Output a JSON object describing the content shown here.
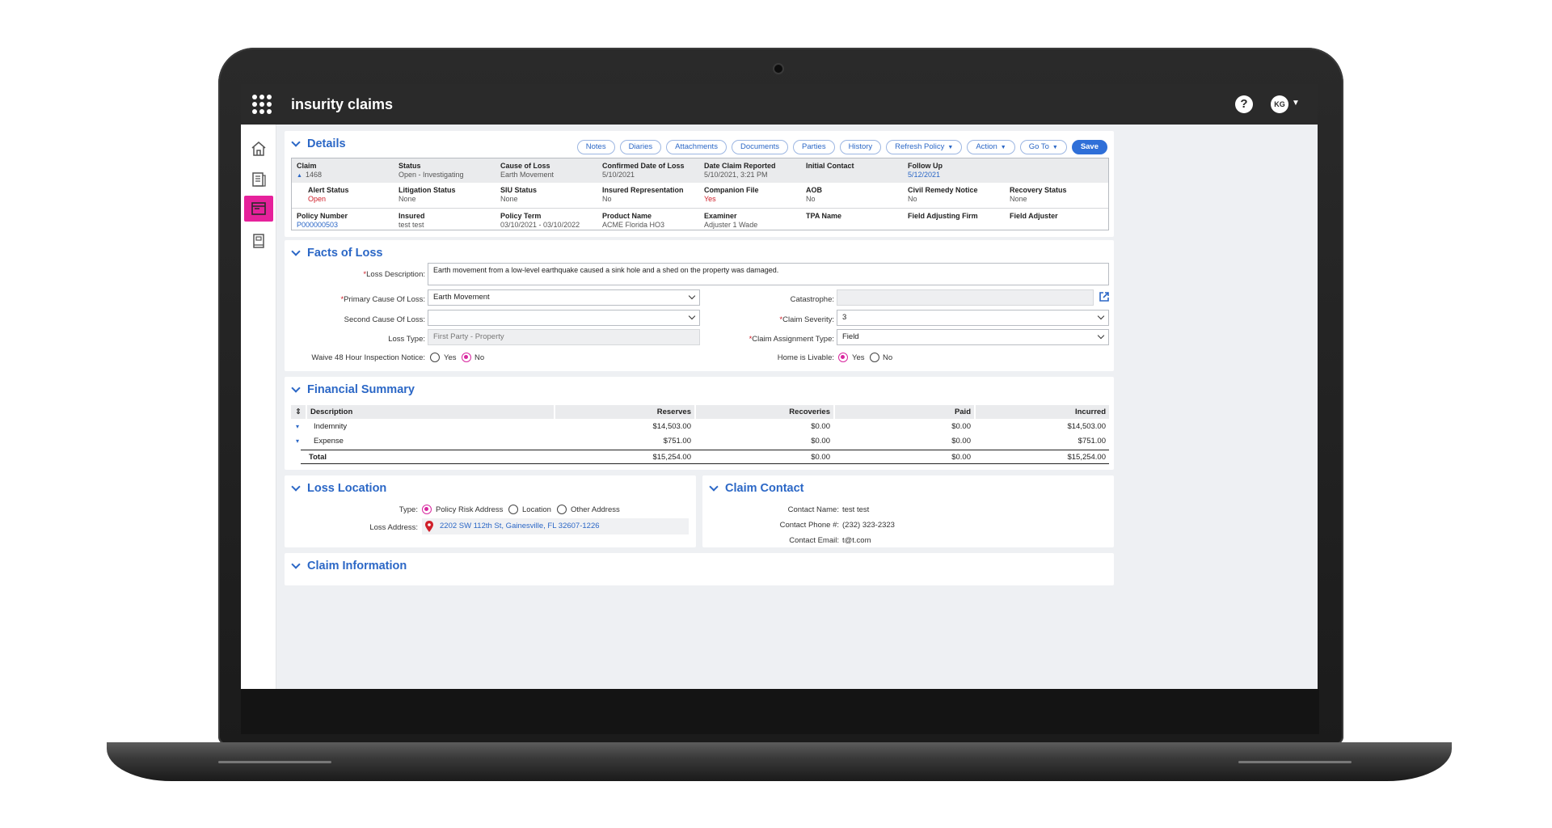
{
  "app": {
    "title": "insurity claims",
    "help_icon": "?",
    "avatar_initials": "KG"
  },
  "sidebar": {
    "items": [
      "home-icon",
      "document-icon",
      "claim-folder-icon",
      "ledger-icon"
    ]
  },
  "details": {
    "title": "Details",
    "toolbar": {
      "notes": "Notes",
      "diaries": "Diaries",
      "attachments": "Attachments",
      "documents": "Documents",
      "parties": "Parties",
      "history": "History",
      "refresh_policy": "Refresh Policy",
      "action": "Action",
      "go_to": "Go To",
      "save": "Save"
    },
    "row1": [
      {
        "label": "Claim",
        "value": "1468"
      },
      {
        "label": "Status",
        "value": "Open - Investigating"
      },
      {
        "label": "Cause of Loss",
        "value": "Earth Movement"
      },
      {
        "label": "Confirmed Date of Loss",
        "value": "5/10/2021"
      },
      {
        "label": "Date Claim Reported",
        "value": "5/10/2021, 3:21 PM"
      },
      {
        "label": "Initial Contact",
        "value": ""
      },
      {
        "label": "Follow Up",
        "value": "5/12/2021"
      }
    ],
    "row2": [
      {
        "label": "Alert Status",
        "value": "Open"
      },
      {
        "label": "Litigation Status",
        "value": "None"
      },
      {
        "label": "SIU Status",
        "value": "None"
      },
      {
        "label": "Insured Representation",
        "value": "No"
      },
      {
        "label": "Companion File",
        "value": "Yes"
      },
      {
        "label": "AOB",
        "value": "No"
      },
      {
        "label": "Civil Remedy Notice",
        "value": "No"
      },
      {
        "label": "Recovery Status",
        "value": "None"
      }
    ],
    "row3": [
      {
        "label": "Policy Number",
        "value": "P000000503"
      },
      {
        "label": "Insured",
        "value": "test test"
      },
      {
        "label": "Policy Term",
        "value": "03/10/2021 - 03/10/2022"
      },
      {
        "label": "Product Name",
        "value": "ACME Florida HO3"
      },
      {
        "label": "Examiner",
        "value": "Adjuster 1 Wade"
      },
      {
        "label": "TPA Name",
        "value": ""
      },
      {
        "label": "Field Adjusting Firm",
        "value": ""
      },
      {
        "label": "Field Adjuster",
        "value": ""
      }
    ]
  },
  "facts": {
    "title": "Facts of Loss",
    "loss_description_label": "Loss Description:",
    "loss_description": "Earth movement from a low-level earthquake caused a sink hole and a shed on the property was damaged.",
    "primary_cause_label": "Primary Cause Of Loss:",
    "primary_cause": "Earth Movement",
    "second_cause_label": "Second Cause Of Loss:",
    "second_cause": "",
    "loss_type_label": "Loss Type:",
    "loss_type": "First Party - Property",
    "waive_label": "Waive 48 Hour Inspection Notice:",
    "yes": "Yes",
    "no": "No",
    "catastrophe_label": "Catastrophe:",
    "claim_severity_label": "Claim Severity:",
    "claim_severity": "3",
    "assignment_type_label": "Claim Assignment Type:",
    "assignment_type": "Field",
    "livable_label": "Home is Livable:"
  },
  "financial": {
    "title": "Financial Summary",
    "columns": [
      "Description",
      "Reserves",
      "Recoveries",
      "Paid",
      "Incurred"
    ],
    "rows": [
      {
        "description": "Indemnity",
        "reserves": "$14,503.00",
        "recoveries": "$0.00",
        "paid": "$0.00",
        "incurred": "$14,503.00"
      },
      {
        "description": "Expense",
        "reserves": "$751.00",
        "recoveries": "$0.00",
        "paid": "$0.00",
        "incurred": "$751.00"
      }
    ],
    "total": {
      "description": "Total",
      "reserves": "$15,254.00",
      "recoveries": "$0.00",
      "paid": "$0.00",
      "incurred": "$15,254.00"
    }
  },
  "loss_location": {
    "title": "Loss Location",
    "type_label": "Type:",
    "options": [
      "Policy Risk Address",
      "Location",
      "Other Address"
    ],
    "address_label": "Loss Address:",
    "address": "2202 SW 112th St, Gainesville, FL 32607-1226"
  },
  "claim_contact": {
    "title": "Claim Contact",
    "name_label": "Contact Name:",
    "name": "test test",
    "phone_label": "Contact Phone #:",
    "phone": "(232) 323-2323",
    "email_label": "Contact Email:",
    "email": "t@t.com"
  },
  "claim_information": {
    "title": "Claim Information"
  },
  "colors": {
    "accent": "#2b67c6",
    "brand_pink": "#e6219b",
    "alert_red": "#d0202a",
    "topbar": "#2a2a2a"
  }
}
